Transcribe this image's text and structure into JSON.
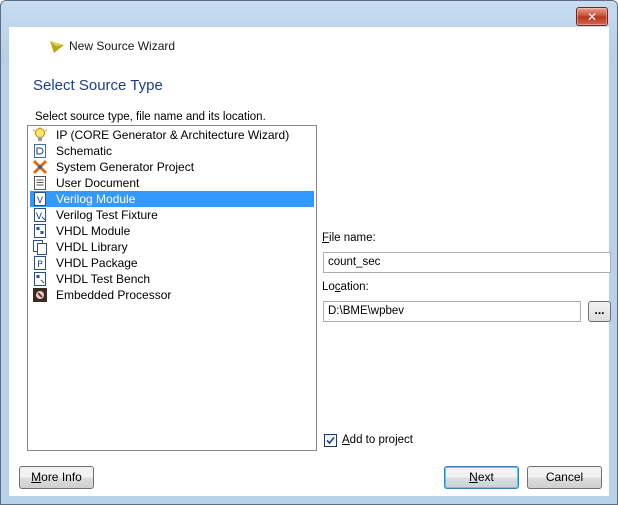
{
  "window": {
    "title": "New Source Wizard",
    "close_glyph": "✕",
    "icon": "wizard-arrow-icon"
  },
  "page": {
    "title": "Select Source Type",
    "instruction": "Select source type, file name and its location."
  },
  "source_types": [
    {
      "label": "IP (CORE Generator & Architecture Wizard)",
      "icon": "ip-bulb-icon",
      "selected": false
    },
    {
      "label": "Schematic",
      "icon": "schematic-icon",
      "selected": false
    },
    {
      "label": "System Generator Project",
      "icon": "sysgen-icon",
      "selected": false
    },
    {
      "label": "User Document",
      "icon": "document-icon",
      "selected": false
    },
    {
      "label": "Verilog Module",
      "icon": "verilog-module-icon",
      "selected": true
    },
    {
      "label": "Verilog Test Fixture",
      "icon": "verilog-test-icon",
      "selected": false
    },
    {
      "label": "VHDL Module",
      "icon": "vhdl-module-icon",
      "selected": false
    },
    {
      "label": "VHDL Library",
      "icon": "vhdl-library-icon",
      "selected": false
    },
    {
      "label": "VHDL Package",
      "icon": "vhdl-package-icon",
      "selected": false
    },
    {
      "label": "VHDL Test Bench",
      "icon": "vhdl-testbench-icon",
      "selected": false
    },
    {
      "label": "Embedded Processor",
      "icon": "processor-icon",
      "selected": false
    }
  ],
  "file_name": {
    "label_underlined": "F",
    "label_rest": "ile name:",
    "value": "count_sec"
  },
  "location": {
    "label_prefix": "Lo",
    "label_underlined": "c",
    "label_rest": "ation:",
    "value": "D:\\BME\\wpbev",
    "browse_label": "..."
  },
  "add_to_project": {
    "checked": true,
    "label_underlined": "A",
    "label_rest": "dd to project"
  },
  "buttons": {
    "more_info_underlined": "M",
    "more_info_rest": "ore Info",
    "next_underlined": "N",
    "next_rest": "ext",
    "cancel": "Cancel"
  },
  "colors": {
    "selection": "#3399ff",
    "title_blue": "#1c3e8a",
    "frame": "#b9d1ea"
  }
}
